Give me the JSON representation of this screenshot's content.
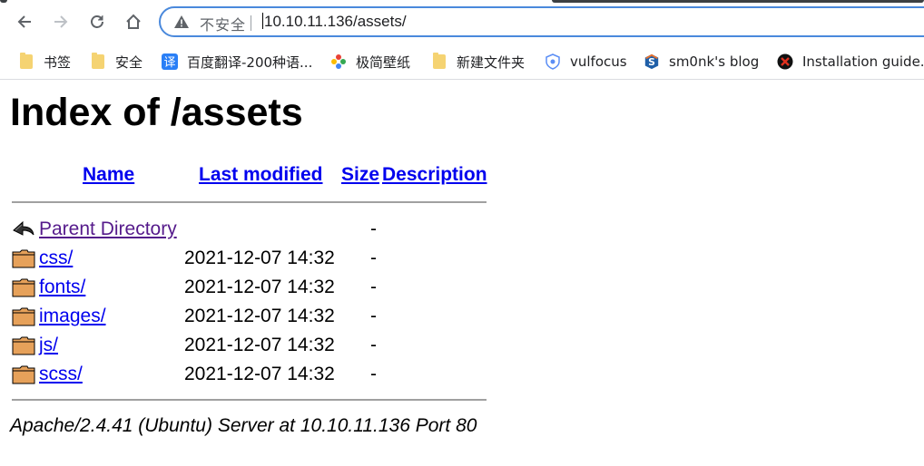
{
  "browser": {
    "url": "10.10.11.136/assets/",
    "security_label": "不安全",
    "bookmarks": [
      {
        "label": "书签",
        "icon": "folder-icon"
      },
      {
        "label": "安全",
        "icon": "folder-icon"
      },
      {
        "label": "百度翻译-200种语...",
        "icon": "baidu-translate-icon"
      },
      {
        "label": "极简壁纸",
        "icon": "wallpaper-icon"
      },
      {
        "label": "新建文件夹",
        "icon": "folder-icon"
      },
      {
        "label": "vulfocus",
        "icon": "shield-icon"
      },
      {
        "label": "sm0nk's blog",
        "icon": "blog-s-icon"
      },
      {
        "label": "Installation guide...",
        "icon": "x-logo-icon"
      }
    ]
  },
  "page": {
    "title": "Index of /assets",
    "columns": {
      "name": "Name",
      "last_modified": "Last modified",
      "size": "Size",
      "description": "Description"
    },
    "entries": [
      {
        "name": "Parent Directory",
        "date": "",
        "size": "-",
        "icon": "back-arrow-icon"
      },
      {
        "name": "css/",
        "date": "2021-12-07 14:32",
        "size": "-",
        "icon": "folder-icon"
      },
      {
        "name": "fonts/",
        "date": "2021-12-07 14:32",
        "size": "-",
        "icon": "folder-icon"
      },
      {
        "name": "images/",
        "date": "2021-12-07 14:32",
        "size": "-",
        "icon": "folder-icon"
      },
      {
        "name": "js/",
        "date": "2021-12-07 14:32",
        "size": "-",
        "icon": "folder-icon"
      },
      {
        "name": "scss/",
        "date": "2021-12-07 14:32",
        "size": "-",
        "icon": "folder-icon"
      }
    ],
    "server_signature": "Apache/2.4.41 (Ubuntu) Server at 10.10.11.136 Port 80"
  },
  "colors": {
    "link": "#0000ee",
    "visited": "#551a8b",
    "omnibox_border": "#4a89dc"
  }
}
